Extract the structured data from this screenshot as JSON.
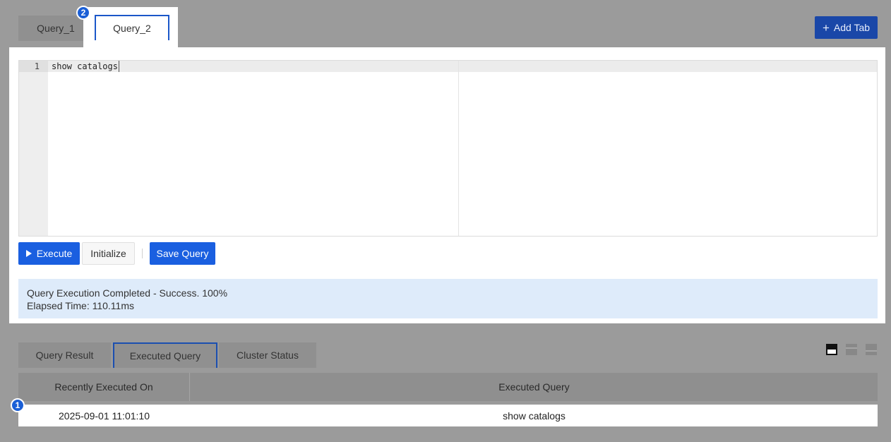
{
  "query_tabs": [
    {
      "label": "Query_1",
      "active": false
    },
    {
      "label": "Query_2",
      "active": true
    }
  ],
  "add_tab": {
    "icon": "plus-icon",
    "label": "Add Tab"
  },
  "editor": {
    "line_number": "1",
    "code": "show catalogs"
  },
  "actions": {
    "execute_label": "Execute",
    "initialize_label": "Initialize",
    "save_label": "Save Query"
  },
  "status": {
    "line1": "Query Execution Completed - Success. 100%",
    "line2": "Elapsed Time: 110.11ms"
  },
  "result_tabs": [
    {
      "label": "Query Result",
      "active": false
    },
    {
      "label": "Executed Query",
      "active": true
    },
    {
      "label": "Cluster Status",
      "active": false
    }
  ],
  "table": {
    "columns": [
      "Recently Executed On",
      "Executed Query"
    ],
    "rows": [
      [
        "2025-09-01 11:01:10",
        "show catalogs"
      ]
    ]
  },
  "markers": {
    "badge1": "1",
    "badge2": "2"
  },
  "colors": {
    "accent": "#1a5fe0",
    "status_bg": "#deebfa",
    "overlay": "#9b9b9b"
  }
}
